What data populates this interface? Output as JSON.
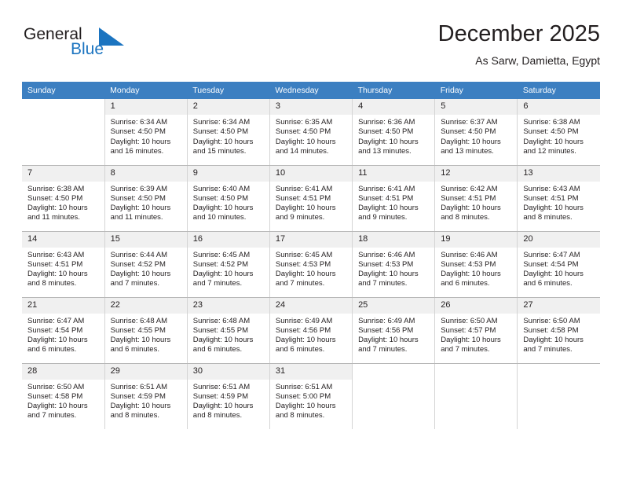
{
  "brand": {
    "word_general": "General",
    "word_blue": "Blue",
    "flag_icon": "triangle-flag-icon",
    "accent_color": "#1b74c0"
  },
  "header": {
    "title": "December 2025",
    "subtitle": "As Sarw, Damietta, Egypt"
  },
  "calendar": {
    "header_bg": "#3c7fc1",
    "weekdays": [
      "Sunday",
      "Monday",
      "Tuesday",
      "Wednesday",
      "Thursday",
      "Friday",
      "Saturday"
    ],
    "weeks": [
      [
        {
          "day": "",
          "lines": []
        },
        {
          "day": "1",
          "lines": [
            "Sunrise: 6:34 AM",
            "Sunset: 4:50 PM",
            "Daylight: 10 hours",
            "and 16 minutes."
          ]
        },
        {
          "day": "2",
          "lines": [
            "Sunrise: 6:34 AM",
            "Sunset: 4:50 PM",
            "Daylight: 10 hours",
            "and 15 minutes."
          ]
        },
        {
          "day": "3",
          "lines": [
            "Sunrise: 6:35 AM",
            "Sunset: 4:50 PM",
            "Daylight: 10 hours",
            "and 14 minutes."
          ]
        },
        {
          "day": "4",
          "lines": [
            "Sunrise: 6:36 AM",
            "Sunset: 4:50 PM",
            "Daylight: 10 hours",
            "and 13 minutes."
          ]
        },
        {
          "day": "5",
          "lines": [
            "Sunrise: 6:37 AM",
            "Sunset: 4:50 PM",
            "Daylight: 10 hours",
            "and 13 minutes."
          ]
        },
        {
          "day": "6",
          "lines": [
            "Sunrise: 6:38 AM",
            "Sunset: 4:50 PM",
            "Daylight: 10 hours",
            "and 12 minutes."
          ]
        }
      ],
      [
        {
          "day": "7",
          "lines": [
            "Sunrise: 6:38 AM",
            "Sunset: 4:50 PM",
            "Daylight: 10 hours",
            "and 11 minutes."
          ]
        },
        {
          "day": "8",
          "lines": [
            "Sunrise: 6:39 AM",
            "Sunset: 4:50 PM",
            "Daylight: 10 hours",
            "and 11 minutes."
          ]
        },
        {
          "day": "9",
          "lines": [
            "Sunrise: 6:40 AM",
            "Sunset: 4:50 PM",
            "Daylight: 10 hours",
            "and 10 minutes."
          ]
        },
        {
          "day": "10",
          "lines": [
            "Sunrise: 6:41 AM",
            "Sunset: 4:51 PM",
            "Daylight: 10 hours",
            "and 9 minutes."
          ]
        },
        {
          "day": "11",
          "lines": [
            "Sunrise: 6:41 AM",
            "Sunset: 4:51 PM",
            "Daylight: 10 hours",
            "and 9 minutes."
          ]
        },
        {
          "day": "12",
          "lines": [
            "Sunrise: 6:42 AM",
            "Sunset: 4:51 PM",
            "Daylight: 10 hours",
            "and 8 minutes."
          ]
        },
        {
          "day": "13",
          "lines": [
            "Sunrise: 6:43 AM",
            "Sunset: 4:51 PM",
            "Daylight: 10 hours",
            "and 8 minutes."
          ]
        }
      ],
      [
        {
          "day": "14",
          "lines": [
            "Sunrise: 6:43 AM",
            "Sunset: 4:51 PM",
            "Daylight: 10 hours",
            "and 8 minutes."
          ]
        },
        {
          "day": "15",
          "lines": [
            "Sunrise: 6:44 AM",
            "Sunset: 4:52 PM",
            "Daylight: 10 hours",
            "and 7 minutes."
          ]
        },
        {
          "day": "16",
          "lines": [
            "Sunrise: 6:45 AM",
            "Sunset: 4:52 PM",
            "Daylight: 10 hours",
            "and 7 minutes."
          ]
        },
        {
          "day": "17",
          "lines": [
            "Sunrise: 6:45 AM",
            "Sunset: 4:53 PM",
            "Daylight: 10 hours",
            "and 7 minutes."
          ]
        },
        {
          "day": "18",
          "lines": [
            "Sunrise: 6:46 AM",
            "Sunset: 4:53 PM",
            "Daylight: 10 hours",
            "and 7 minutes."
          ]
        },
        {
          "day": "19",
          "lines": [
            "Sunrise: 6:46 AM",
            "Sunset: 4:53 PM",
            "Daylight: 10 hours",
            "and 6 minutes."
          ]
        },
        {
          "day": "20",
          "lines": [
            "Sunrise: 6:47 AM",
            "Sunset: 4:54 PM",
            "Daylight: 10 hours",
            "and 6 minutes."
          ]
        }
      ],
      [
        {
          "day": "21",
          "lines": [
            "Sunrise: 6:47 AM",
            "Sunset: 4:54 PM",
            "Daylight: 10 hours",
            "and 6 minutes."
          ]
        },
        {
          "day": "22",
          "lines": [
            "Sunrise: 6:48 AM",
            "Sunset: 4:55 PM",
            "Daylight: 10 hours",
            "and 6 minutes."
          ]
        },
        {
          "day": "23",
          "lines": [
            "Sunrise: 6:48 AM",
            "Sunset: 4:55 PM",
            "Daylight: 10 hours",
            "and 6 minutes."
          ]
        },
        {
          "day": "24",
          "lines": [
            "Sunrise: 6:49 AM",
            "Sunset: 4:56 PM",
            "Daylight: 10 hours",
            "and 6 minutes."
          ]
        },
        {
          "day": "25",
          "lines": [
            "Sunrise: 6:49 AM",
            "Sunset: 4:56 PM",
            "Daylight: 10 hours",
            "and 7 minutes."
          ]
        },
        {
          "day": "26",
          "lines": [
            "Sunrise: 6:50 AM",
            "Sunset: 4:57 PM",
            "Daylight: 10 hours",
            "and 7 minutes."
          ]
        },
        {
          "day": "27",
          "lines": [
            "Sunrise: 6:50 AM",
            "Sunset: 4:58 PM",
            "Daylight: 10 hours",
            "and 7 minutes."
          ]
        }
      ],
      [
        {
          "day": "28",
          "lines": [
            "Sunrise: 6:50 AM",
            "Sunset: 4:58 PM",
            "Daylight: 10 hours",
            "and 7 minutes."
          ]
        },
        {
          "day": "29",
          "lines": [
            "Sunrise: 6:51 AM",
            "Sunset: 4:59 PM",
            "Daylight: 10 hours",
            "and 8 minutes."
          ]
        },
        {
          "day": "30",
          "lines": [
            "Sunrise: 6:51 AM",
            "Sunset: 4:59 PM",
            "Daylight: 10 hours",
            "and 8 minutes."
          ]
        },
        {
          "day": "31",
          "lines": [
            "Sunrise: 6:51 AM",
            "Sunset: 5:00 PM",
            "Daylight: 10 hours",
            "and 8 minutes."
          ]
        },
        {
          "day": "",
          "lines": []
        },
        {
          "day": "",
          "lines": []
        },
        {
          "day": "",
          "lines": []
        }
      ]
    ]
  }
}
